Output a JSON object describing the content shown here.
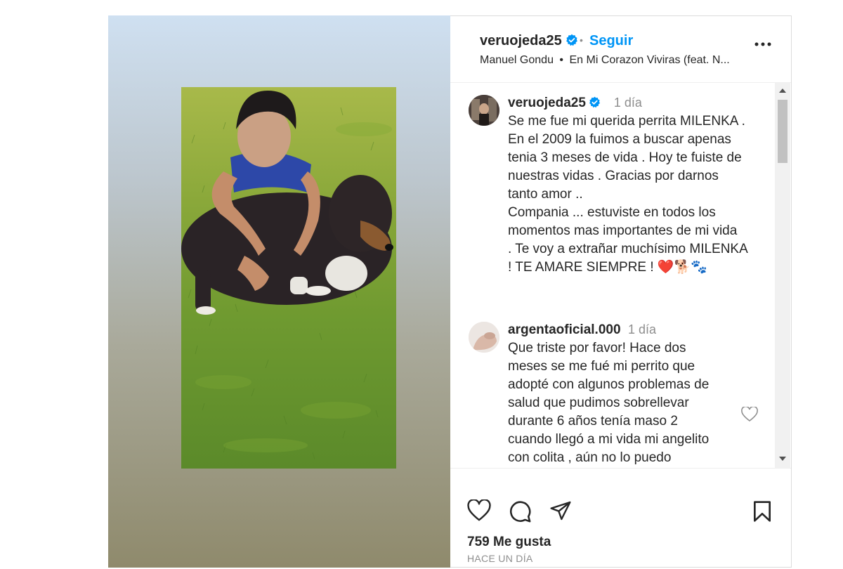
{
  "header": {
    "username": "veruojeda25",
    "separator": "•",
    "follow_label": "Seguir",
    "music_artist": "Manuel Gondu",
    "music_separator": "•",
    "music_title": "En Mi Corazon Viviras (feat. N..."
  },
  "post": {
    "username": "veruojeda25",
    "time": "1 día",
    "caption": "Se me fue mi querida perrita MILENKA .\nEn el 2009 la fuimos a buscar apenas\ntenia 3 meses de vida . Hoy te fuiste de\nnuestras vidas . Gracias por darnos\ntanto amor ..\nCompania ... estuviste en todos los\nmomentos mas importantes de mi vida\n. Te voy a extrañar muchísimo MILENKA\n! TE AMARE SIEMPRE ! ❤️🐕🐾"
  },
  "comments": [
    {
      "username": "argentaoficial.000",
      "time": "1 día",
      "text": "Que triste por favor! Hace dos\nmeses se me fué mi perrito que\nadopté con algunos problemas de\nsalud que pudimos sobrellevar\ndurante 6 años tenía maso 2\ncuando llegó a mi vida mi angelito\ncon colita , aún no lo puedo"
    }
  ],
  "footer": {
    "likes": "759 Me gusta",
    "timestamp": "HACE UN DÍA"
  },
  "colors": {
    "accent": "#0095f6",
    "verified": "#0095f6",
    "text": "#262626",
    "muted": "#8e8e8e"
  },
  "icons": [
    "verified-icon",
    "more-icon",
    "heart-icon",
    "comment-icon",
    "share-icon",
    "bookmark-icon",
    "scroll-up-icon",
    "scroll-down-icon"
  ]
}
